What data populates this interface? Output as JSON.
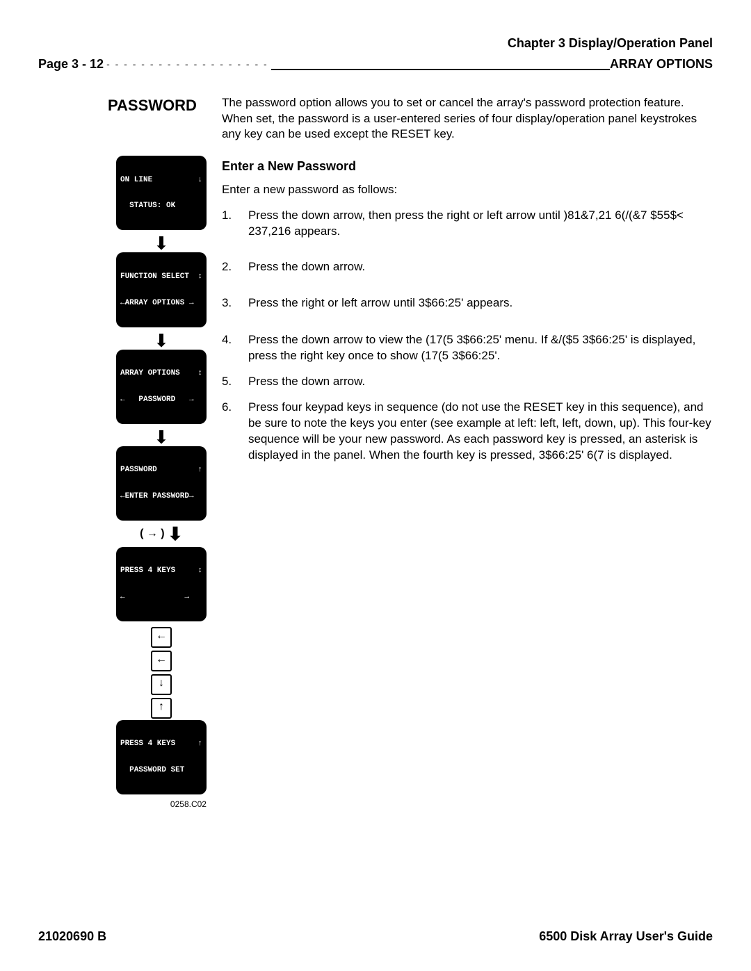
{
  "header": {
    "chapter": "Chapter 3   Display/Operation Panel",
    "page": "Page 3 - 12",
    "section": "ARRAY OPTIONS",
    "dashes": "- - - - - - - - - - - - - - - - - - -"
  },
  "title": "PASSWORD",
  "intro": "The password option allows you to set or cancel the array's password protection feature. When set, the password is a user-entered series of four display/operation panel keystrokes any key can be used except the RESET key.",
  "sub_heading": "Enter a New Password",
  "sub_intro": "Enter a new password as follows:",
  "steps": [
    {
      "n": "1.",
      "t": "Press the down arrow, then press the right or left arrow until )81&7,21 6(/(&7 $55$< 237,216 appears."
    },
    {
      "n": "2.",
      "t": "Press the down arrow."
    },
    {
      "n": "3.",
      "t": "Press the right or left arrow until 3$66:25' appears."
    },
    {
      "n": "4.",
      "t": "Press the down arrow to view the (17(5 3$66:25' menu. If &/($5 3$66:25' is displayed, press the right key once to show (17(5 3$66:25'."
    },
    {
      "n": "5.",
      "t": "Press the down arrow."
    },
    {
      "n": "6.",
      "t": "Press four keypad keys in sequence (do not use the RESET key in this sequence), and be sure to note the keys you enter (see example at left: left, left, down, up). This four-key sequence will be your new password. As each password key is pressed, an asterisk is displayed in the panel. When the fourth key is pressed, 3$66:25' 6(7 is displayed."
    }
  ],
  "panels": {
    "p1_l1": "ON LINE",
    "p1_l1r": "↓",
    "p1_l2": "  STATUS: OK",
    "p2_l1": "FUNCTION SELECT",
    "p2_l1r": "↕",
    "p2_l2": "←ARRAY OPTIONS →",
    "p3_l1": "ARRAY OPTIONS",
    "p3_l1r": "↕",
    "p3_l2": "←   PASSWORD   →",
    "p4_l1": "PASSWORD",
    "p4_l1r": "↑",
    "p4_l2": "←ENTER PASSWORD→",
    "p5_l1": "PRESS 4 KEYS",
    "p5_l1r": "↕",
    "p5_l2": "←             →",
    "p6_l1": "PRESS 4 KEYS",
    "p6_l1r": "↑",
    "p6_l2": "  PASSWORD SET"
  },
  "glyphs": {
    "down": "⬇",
    "left": "←",
    "up": "↑",
    "downk": "↓",
    "right": "→",
    "paren": "(  →   )"
  },
  "caption": "0258.C02",
  "footer": {
    "doc": "21020690 B",
    "title": "6500 Disk Array User's Guide"
  }
}
